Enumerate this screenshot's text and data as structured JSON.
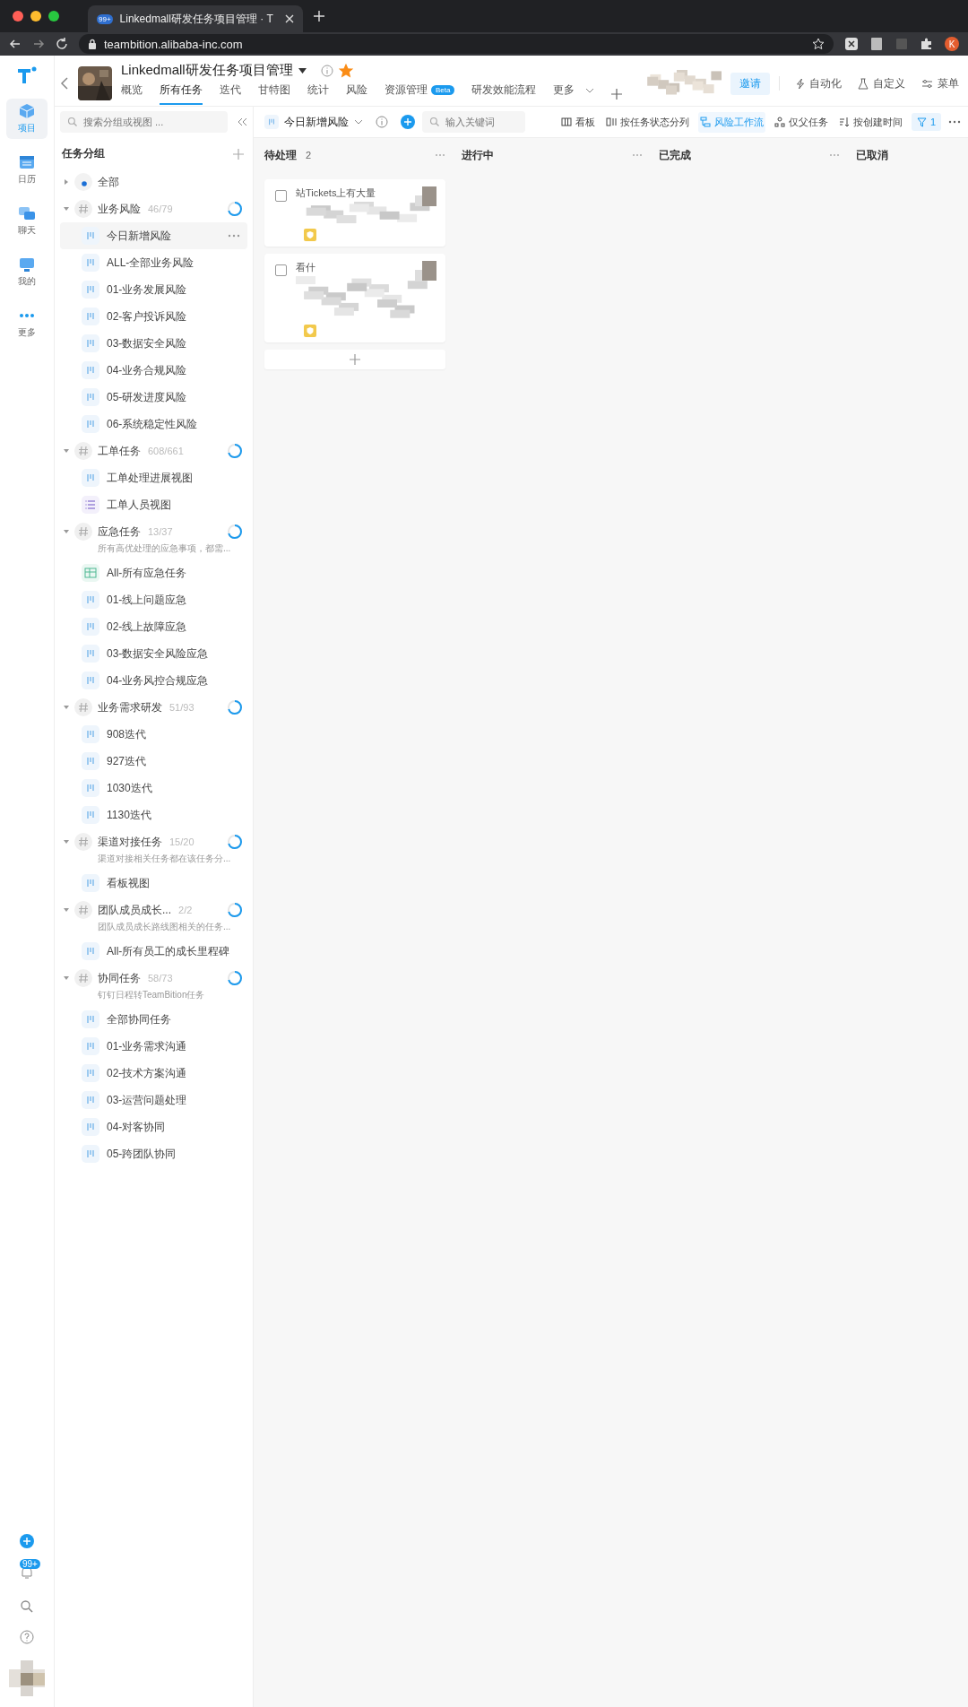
{
  "browser": {
    "tab_title": "Linkedmall研发任务项目管理 · T",
    "tab_badge": "99+",
    "url": "teambition.alibaba-inc.com",
    "profile": "K"
  },
  "rail": {
    "items": [
      {
        "kind": "project",
        "label": "项目",
        "selected": true
      },
      {
        "kind": "calendar",
        "label": "日历",
        "selected": false
      },
      {
        "kind": "chat",
        "label": "聊天",
        "selected": false
      },
      {
        "kind": "me",
        "label": "我的",
        "selected": false
      },
      {
        "kind": "more",
        "label": "更多",
        "selected": false
      }
    ],
    "badge": "99+"
  },
  "project": {
    "title": "Linkedmall研发任务项目管理",
    "starred": true,
    "tabs": [
      {
        "label": "概览",
        "selected": false
      },
      {
        "label": "所有任务",
        "selected": true
      },
      {
        "label": "迭代",
        "selected": false
      },
      {
        "label": "甘特图",
        "selected": false
      },
      {
        "label": "统计",
        "selected": false
      },
      {
        "label": "风险",
        "selected": false
      },
      {
        "label": "资源管理",
        "badge": "Beta",
        "selected": false
      },
      {
        "label": "研发效能流程",
        "selected": false
      },
      {
        "label": "更多",
        "selected": false
      }
    ],
    "invite": "邀请",
    "actions": [
      {
        "kind": "automation",
        "label": "自动化"
      },
      {
        "kind": "custom",
        "label": "自定义"
      },
      {
        "kind": "menu",
        "label": "菜单"
      }
    ]
  },
  "toolbar": {
    "search_placeholder": "搜索分组或视图 ...",
    "view": "今日新增风险",
    "keyword_placeholder": "输入关键词",
    "options": [
      {
        "kind": "board",
        "label": "看板",
        "selected": false
      },
      {
        "kind": "columns",
        "label": "按任务状态分列",
        "selected": false
      },
      {
        "kind": "flow",
        "label": "风险工作流",
        "selected": true
      },
      {
        "kind": "parent",
        "label": "仅父任务",
        "selected": false
      },
      {
        "kind": "sort",
        "label": "按创建时间",
        "selected": false
      }
    ],
    "filter_count": "1"
  },
  "sidebar": {
    "title": "任务分组",
    "tree": [
      {
        "kind": "all",
        "label": "全部",
        "expanded": false
      },
      {
        "kind": "group",
        "label": "业务风险",
        "count": "46/79",
        "expanded": true,
        "children": [
          {
            "kind": "board",
            "label": "今日新增风险",
            "selected": true
          },
          {
            "kind": "board",
            "label": "ALL-全部业务风险",
            "selected": false
          },
          {
            "kind": "board",
            "label": "01-业务发展风险",
            "selected": false
          },
          {
            "kind": "board",
            "label": "02-客户投诉风险",
            "selected": false
          },
          {
            "kind": "board",
            "label": "03-数据安全风险",
            "selected": false
          },
          {
            "kind": "board",
            "label": "04-业务合规风险",
            "selected": false
          },
          {
            "kind": "board",
            "label": "05-研发进度风险",
            "selected": false
          },
          {
            "kind": "board",
            "label": "06-系统稳定性风险",
            "selected": false
          }
        ]
      },
      {
        "kind": "group",
        "label": "工单任务",
        "count": "608/661",
        "expanded": true,
        "children": [
          {
            "kind": "board",
            "label": "工单处理进展视图",
            "selected": false
          },
          {
            "kind": "list",
            "label": "工单人员视图",
            "selected": false
          }
        ]
      },
      {
        "kind": "group",
        "label": "应急任务",
        "count": "13/37",
        "description": "所有高优处理的应急事项，都需...",
        "expanded": true,
        "children": [
          {
            "kind": "table",
            "label": "All-所有应急任务",
            "selected": false
          },
          {
            "kind": "board",
            "label": "01-线上问题应急",
            "selected": false
          },
          {
            "kind": "board",
            "label": "02-线上故障应急",
            "selected": false
          },
          {
            "kind": "board",
            "label": "03-数据安全风险应急",
            "selected": false
          },
          {
            "kind": "board",
            "label": "04-业务风控合规应急",
            "selected": false
          }
        ]
      },
      {
        "kind": "group",
        "label": "业务需求研发",
        "count": "51/93",
        "expanded": true,
        "children": [
          {
            "kind": "board",
            "label": "908迭代",
            "selected": false
          },
          {
            "kind": "board",
            "label": "927迭代",
            "selected": false
          },
          {
            "kind": "board",
            "label": "1030迭代",
            "selected": false
          },
          {
            "kind": "board",
            "label": "1130迭代",
            "selected": false
          }
        ]
      },
      {
        "kind": "group",
        "label": "渠道对接任务",
        "count": "15/20",
        "description": "渠道对接相关任务都在该任务分...",
        "expanded": true,
        "children": [
          {
            "kind": "board",
            "label": "看板视图",
            "selected": false
          }
        ]
      },
      {
        "kind": "group",
        "label": "团队成员成长...",
        "count": "2/2",
        "description": "团队成员成长路线图相关的任务...",
        "expanded": true,
        "children": [
          {
            "kind": "board",
            "label": "All-所有员工的成长里程碑",
            "selected": false
          }
        ]
      },
      {
        "kind": "group",
        "label": "协同任务",
        "count": "58/73",
        "description": "钉钉日程转TeamBition任务",
        "expanded": true,
        "children": [
          {
            "kind": "board",
            "label": "全部协同任务",
            "selected": false
          },
          {
            "kind": "board",
            "label": "01-业务需求沟通",
            "selected": false
          },
          {
            "kind": "board",
            "label": "02-技术方案沟通",
            "selected": false
          },
          {
            "kind": "board",
            "label": "03-运营问题处理",
            "selected": false
          },
          {
            "kind": "board",
            "label": "04-对客协同",
            "selected": false
          },
          {
            "kind": "board",
            "label": "05-跨团队协同",
            "selected": false
          }
        ]
      }
    ]
  },
  "board": {
    "columns": [
      {
        "title": "待处理",
        "count": "2",
        "cards": [
          {
            "title": "站Tickets上有大量",
            "checked": false
          },
          {
            "title": "看什",
            "checked": false
          }
        ]
      },
      {
        "title": "进行中"
      },
      {
        "title": "已完成"
      },
      {
        "title": "已取消"
      }
    ]
  }
}
